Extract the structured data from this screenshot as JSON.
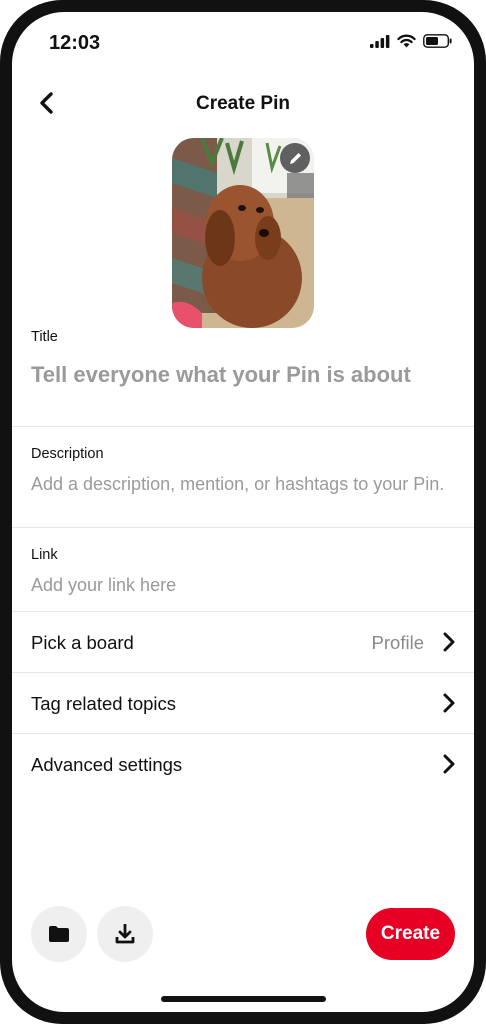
{
  "status_bar": {
    "time": "12:03",
    "icons": [
      "signal-icon",
      "wifi-icon",
      "battery-icon"
    ]
  },
  "header": {
    "title": "Create Pin",
    "back_icon": "chevron-left-icon"
  },
  "image": {
    "description_icon": "photo-thumbnail",
    "edit_icon": "pencil-icon"
  },
  "title_field": {
    "label": "Title",
    "placeholder": "Tell everyone what your Pin is about"
  },
  "description_field": {
    "label": "Description",
    "placeholder": "Add a description, mention, or hashtags to your Pin."
  },
  "link_field": {
    "label": "Link",
    "placeholder": "Add your link here"
  },
  "rows": {
    "board": {
      "label": "Pick a board",
      "value": "Profile"
    },
    "topics": {
      "label": "Tag related topics"
    },
    "advanced": {
      "label": "Advanced settings"
    }
  },
  "footer": {
    "left_buttons": [
      "folder-icon",
      "download-icon"
    ],
    "create_label": "Create",
    "accent": "#e60023"
  }
}
